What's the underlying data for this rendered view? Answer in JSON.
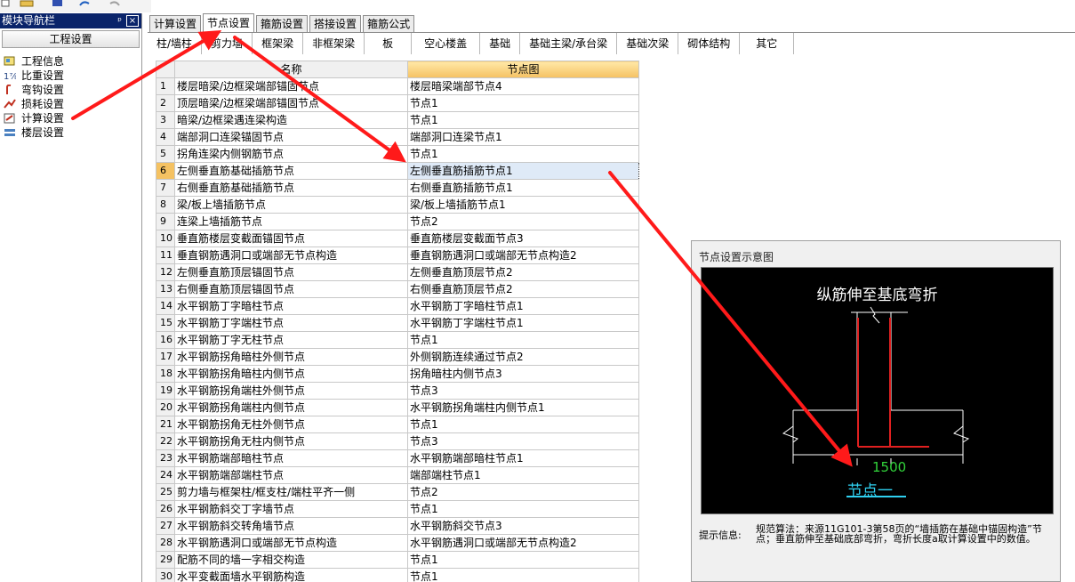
{
  "nav": {
    "title": "模块导航栏",
    "pin_symbol": "ᵖ",
    "close_symbol": "×",
    "header": "工程设置",
    "items": [
      {
        "label": "工程信息",
        "icon": "project-info-icon"
      },
      {
        "label": "比重设置",
        "icon": "weight-icon"
      },
      {
        "label": "弯钩设置",
        "icon": "hook-icon"
      },
      {
        "label": "损耗设置",
        "icon": "loss-icon"
      },
      {
        "label": "计算设置",
        "icon": "calc-settings-icon"
      },
      {
        "label": "楼层设置",
        "icon": "floor-settings-icon"
      }
    ]
  },
  "tabs": [
    {
      "label": "计算设置",
      "active": false
    },
    {
      "label": "节点设置",
      "active": true
    },
    {
      "label": "箍筋设置",
      "active": false
    },
    {
      "label": "搭接设置",
      "active": false
    },
    {
      "label": "箍筋公式",
      "active": false
    }
  ],
  "subtabs": [
    "柱/墙柱",
    "剪力墙",
    "框架梁",
    "非框架梁",
    "板",
    "空心楼盖",
    "基础",
    "基础主梁/承台梁",
    "基础次梁",
    "砌体结构",
    "其它"
  ],
  "table": {
    "headers": [
      "名称",
      "节点图"
    ],
    "selected_row": 6,
    "rows": [
      {
        "no": "1",
        "name": "楼层暗梁/边框梁端部锚固节点",
        "node": "楼层暗梁端部节点4"
      },
      {
        "no": "2",
        "name": "顶层暗梁/边框梁端部锚固节点",
        "node": "节点1"
      },
      {
        "no": "3",
        "name": "暗梁/边框梁遇连梁构造",
        "node": "节点1"
      },
      {
        "no": "4",
        "name": "端部洞口连梁锚固节点",
        "node": "端部洞口连梁节点1"
      },
      {
        "no": "5",
        "name": "拐角连梁内侧钢筋节点",
        "node": "节点1"
      },
      {
        "no": "6",
        "name": "左侧垂直筋基础插筋节点",
        "node": "左侧垂直筋插筋节点1"
      },
      {
        "no": "7",
        "name": "右侧垂直筋基础插筋节点",
        "node": "右侧垂直筋插筋节点1"
      },
      {
        "no": "8",
        "name": "梁/板上墙插筋节点",
        "node": "梁/板上墙插筋节点1"
      },
      {
        "no": "9",
        "name": "连梁上墙插筋节点",
        "node": "节点2"
      },
      {
        "no": "10",
        "name": "垂直筋楼层变截面锚固节点",
        "node": "垂直筋楼层变截面节点3"
      },
      {
        "no": "11",
        "name": "垂直钢筋遇洞口或端部无节点构造",
        "node": "垂直钢筋遇洞口或端部无节点构造2"
      },
      {
        "no": "12",
        "name": "左侧垂直筋顶层锚固节点",
        "node": "左侧垂直筋顶层节点2"
      },
      {
        "no": "13",
        "name": "右侧垂直筋顶层锚固节点",
        "node": "右侧垂直筋顶层节点2"
      },
      {
        "no": "14",
        "name": "水平钢筋丁字暗柱节点",
        "node": "水平钢筋丁字暗柱节点1"
      },
      {
        "no": "15",
        "name": "水平钢筋丁字端柱节点",
        "node": "水平钢筋丁字端柱节点1"
      },
      {
        "no": "16",
        "name": "水平钢筋丁字无柱节点",
        "node": "节点1"
      },
      {
        "no": "17",
        "name": "水平钢筋拐角暗柱外侧节点",
        "node": "外侧钢筋连续通过节点2"
      },
      {
        "no": "18",
        "name": "水平钢筋拐角暗柱内侧节点",
        "node": "拐角暗柱内侧节点3"
      },
      {
        "no": "19",
        "name": "水平钢筋拐角端柱外侧节点",
        "node": "节点3"
      },
      {
        "no": "20",
        "name": "水平钢筋拐角端柱内侧节点",
        "node": "水平钢筋拐角端柱内侧节点1"
      },
      {
        "no": "21",
        "name": "水平钢筋拐角无柱外侧节点",
        "node": "节点1"
      },
      {
        "no": "22",
        "name": "水平钢筋拐角无柱内侧节点",
        "node": "节点3"
      },
      {
        "no": "23",
        "name": "水平钢筋端部暗柱节点",
        "node": "水平钢筋端部暗柱节点1"
      },
      {
        "no": "24",
        "name": "水平钢筋端部端柱节点",
        "node": "端部端柱节点1"
      },
      {
        "no": "25",
        "name": "剪力墙与框架柱/框支柱/端柱平齐一侧",
        "node": "节点2"
      },
      {
        "no": "26",
        "name": "水平钢筋斜交丁字墙节点",
        "node": "节点1"
      },
      {
        "no": "27",
        "name": "水平钢筋斜交转角墙节点",
        "node": "水平钢筋斜交节点3"
      },
      {
        "no": "28",
        "name": "水平钢筋遇洞口或端部无节点构造",
        "node": "水平钢筋遇洞口或端部无节点构造2"
      },
      {
        "no": "29",
        "name": "配筋不同的墙一字相交构造",
        "node": "节点1"
      },
      {
        "no": "30",
        "name": "水平变截面墙水平钢筋构造",
        "node": "节点1"
      }
    ]
  },
  "preview": {
    "title": "节点设置示意图",
    "diagram_title": "纵筋伸至基底弯折",
    "dimension": "1500",
    "node_label": "节点一",
    "hint_label": "提示信息:",
    "hint_text": "规范算法：来源11G101-3第58页的“墙插筋在基础中锚固构造”节点；垂直筋伸至基础底部弯折，弯折长度a取计算设置中的数值。"
  },
  "colors": {
    "nav_title_bg": "#0a246a",
    "header_gold": "#f5c262",
    "arrow": "#ff1a1a",
    "rebar_red": "#e02020",
    "dim_green": "#31d23a",
    "label_cyan": "#2fd0f0"
  }
}
